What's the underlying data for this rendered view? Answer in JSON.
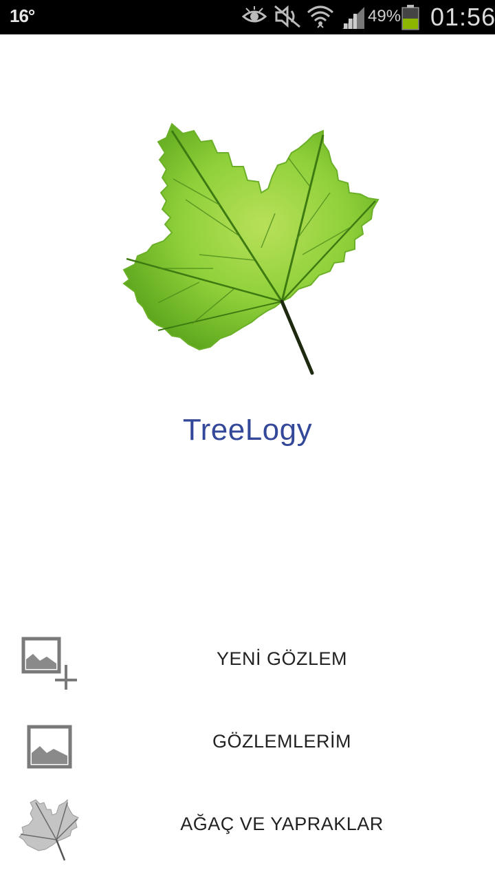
{
  "status_bar": {
    "temperature": "16°",
    "battery_percent": "49%",
    "time": "01:56",
    "icons": [
      "eye-icon",
      "mute-icon",
      "wifi-icon",
      "signal-icon",
      "battery-icon"
    ],
    "battery_color": "#8db600"
  },
  "app": {
    "title": "TreeLogy",
    "title_color": "#34489a",
    "logo": "leaf-logo"
  },
  "menu": {
    "items": [
      {
        "label": "YENİ GÖZLEM",
        "icon": "add-image-icon"
      },
      {
        "label": "GÖZLEMLERİM",
        "icon": "image-icon"
      },
      {
        "label": "AĞAÇ VE YAPRAKLAR",
        "icon": "leaf-icon"
      }
    ]
  }
}
